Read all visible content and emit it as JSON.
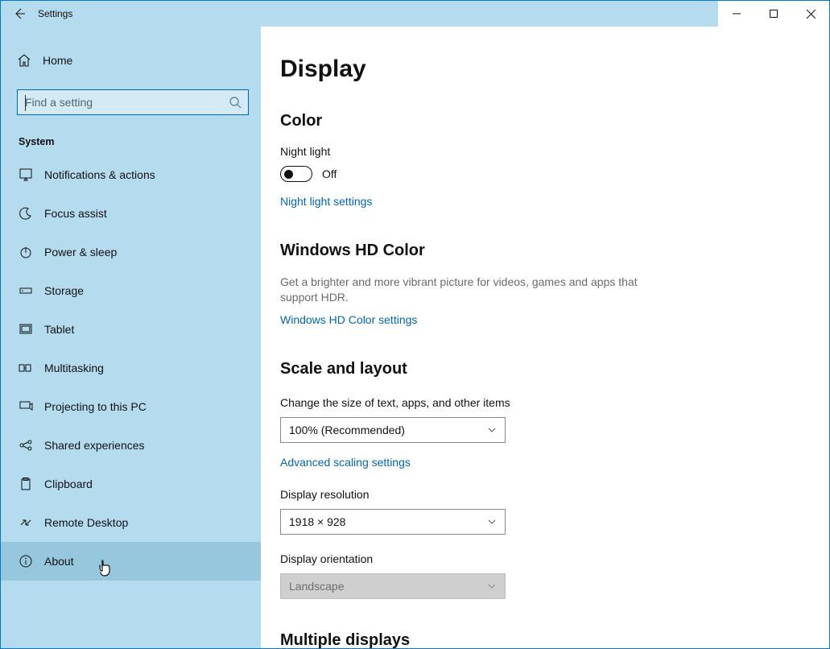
{
  "window": {
    "title": "Settings"
  },
  "sidebar": {
    "home": "Home",
    "search_placeholder": "Find a setting",
    "section": "System",
    "items": [
      {
        "label": "Notifications & actions"
      },
      {
        "label": "Focus assist"
      },
      {
        "label": "Power & sleep"
      },
      {
        "label": "Storage"
      },
      {
        "label": "Tablet"
      },
      {
        "label": "Multitasking"
      },
      {
        "label": "Projecting to this PC"
      },
      {
        "label": "Shared experiences"
      },
      {
        "label": "Clipboard"
      },
      {
        "label": "Remote Desktop"
      },
      {
        "label": "About"
      }
    ]
  },
  "main": {
    "title": "Display",
    "color": {
      "heading": "Color",
      "night_light_label": "Night light",
      "night_light_state": "Off",
      "night_light_link": "Night light settings"
    },
    "hdcolor": {
      "heading": "Windows HD Color",
      "desc": "Get a brighter and more vibrant picture for videos, games and apps that support HDR.",
      "link": "Windows HD Color settings"
    },
    "scale": {
      "heading": "Scale and layout",
      "size_label": "Change the size of text, apps, and other items",
      "size_value": "100% (Recommended)",
      "advanced_link": "Advanced scaling settings",
      "resolution_label": "Display resolution",
      "resolution_value": "1918 × 928",
      "orientation_label": "Display orientation",
      "orientation_value": "Landscape"
    },
    "multi": {
      "heading": "Multiple displays"
    }
  }
}
